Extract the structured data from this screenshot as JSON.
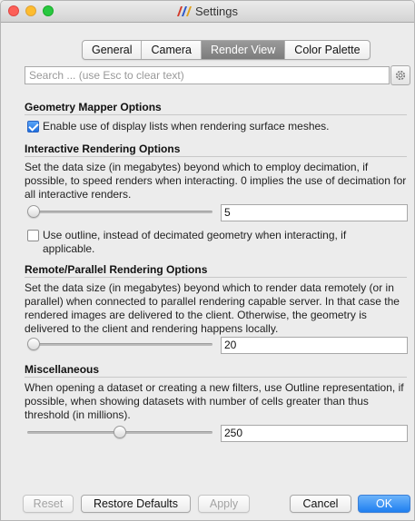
{
  "window": {
    "title": "Settings"
  },
  "tabs": [
    {
      "label": "General",
      "active": false
    },
    {
      "label": "Camera",
      "active": false
    },
    {
      "label": "Render View",
      "active": true
    },
    {
      "label": "Color Palette",
      "active": false
    }
  ],
  "search": {
    "placeholder": "Search ... (use Esc to clear text)",
    "value": ""
  },
  "geometry_mapper": {
    "title": "Geometry Mapper Options",
    "display_lists_label": "Enable use of display lists when rendering surface meshes.",
    "display_lists_checked": true
  },
  "interactive": {
    "title": "Interactive Rendering Options",
    "description": "Set the data size (in megabytes) beyond which to employ decimation, if possible, to speed renders when interacting. 0 implies the use of decimation for all interactive renders.",
    "slider_fraction": 0.0,
    "value": "5",
    "outline_label": "Use outline, instead of decimated geometry when interacting, if applicable.",
    "outline_checked": false
  },
  "remote": {
    "title": "Remote/Parallel Rendering Options",
    "description": "Set the data size (in megabytes) beyond which to render data remotely (or in parallel) when connected to parallel rendering capable server. In that case the rendered images are delivered to the client. Otherwise, the geometry is delivered to the client and rendering happens locally.",
    "slider_fraction": 0.0,
    "value": "20"
  },
  "misc": {
    "title": "Miscellaneous",
    "description": "When opening a dataset or creating a new filters, use Outline representation, if possible, when showing datasets with number of cells greater than thus threshold (in millions).",
    "slider_fraction": 0.5,
    "value": "250"
  },
  "buttons": {
    "reset": "Reset",
    "restore_defaults": "Restore Defaults",
    "apply": "Apply",
    "cancel": "Cancel",
    "ok": "OK"
  },
  "colors": {
    "accent": "#1f7ff0",
    "active_tab": "#8a8a8a"
  }
}
